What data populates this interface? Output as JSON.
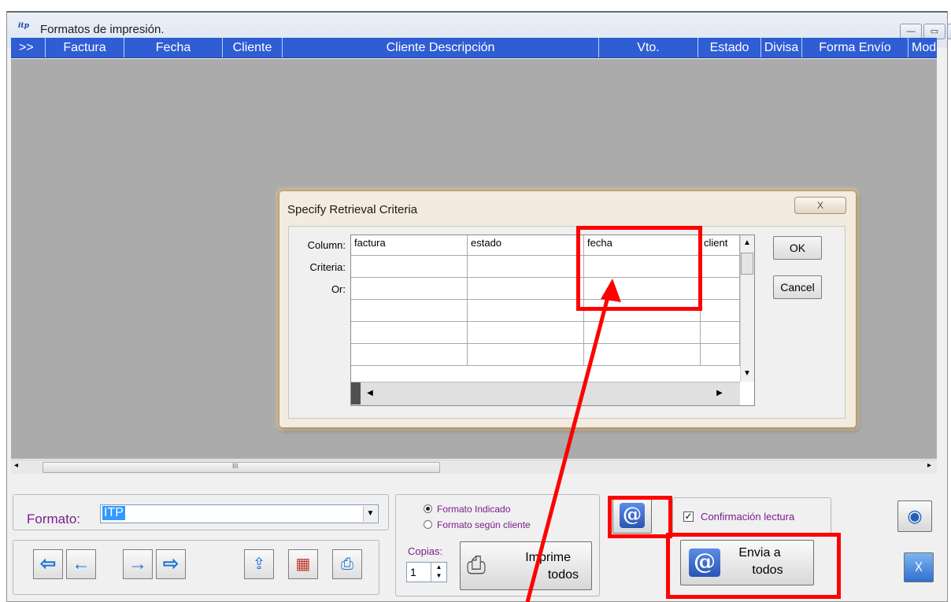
{
  "window": {
    "title": "Formatos de impresión.",
    "caption_buttons": [
      "minimize",
      "maximize",
      "close"
    ]
  },
  "grid": {
    "columns": [
      ">>",
      "Factura",
      "Fecha",
      "Cliente",
      "Cliente Descripción",
      "Vto.",
      "Estado",
      "Divisa",
      "Forma Envío",
      "Moda"
    ]
  },
  "hscroll": {
    "grip": "III"
  },
  "dialog": {
    "title": "Specify Retrieval Criteria",
    "close_glyph": "X",
    "labels": {
      "column": "Column:",
      "criteria": "Criteria:",
      "or": "Or:"
    },
    "columns": [
      "factura",
      "estado",
      "fecha",
      "client"
    ],
    "ok_label": "OK",
    "cancel_label": "Cancel"
  },
  "bottom": {
    "formato_label": "Formato:",
    "formato_value": "ITP",
    "radio_options": [
      {
        "label": "Formato Indicado",
        "selected": true
      },
      {
        "label": "Formato según cliente",
        "selected": false
      }
    ],
    "copias_label": "Copias:",
    "copias_value": "1",
    "imprime_line1": "Imprime",
    "imprime_line2": "todos",
    "confirmacion_label": "Confirmación lectura",
    "confirmacion_checked": true,
    "envia_line1": "Envia a",
    "envia_line2": "todos",
    "nav_icons": [
      "arrow-left-double-icon",
      "arrow-left-icon",
      "arrow-right-icon",
      "arrow-right-double-icon"
    ],
    "tool_icons": [
      "upload-icon",
      "color-cube-icon",
      "printer-icon"
    ]
  },
  "colors": {
    "header_blue": "#2f5dd4",
    "annotation_red": "#ff0000",
    "label_purple": "#7a1f8c"
  }
}
